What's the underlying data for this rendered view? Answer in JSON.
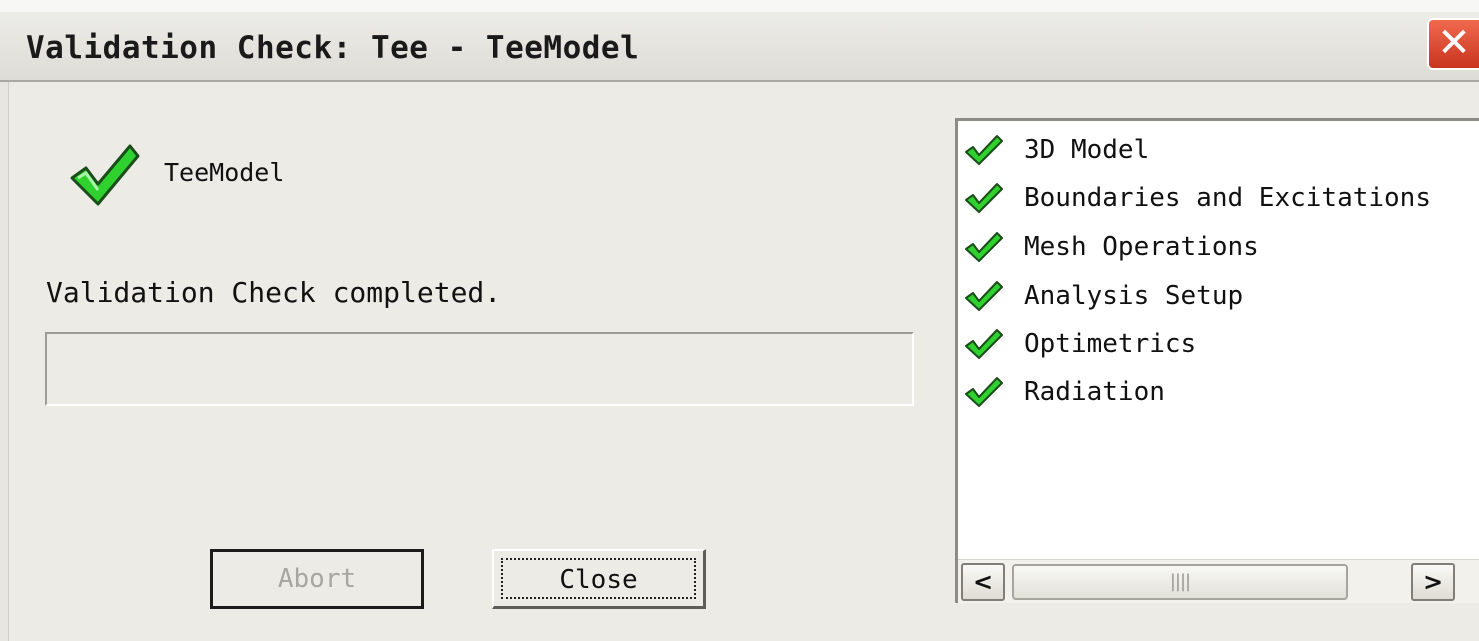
{
  "window": {
    "title": "Validation Check: Tee - TeeModel",
    "close_glyph": "✕"
  },
  "model": {
    "icon": "green-check-icon",
    "name": "TeeModel"
  },
  "status": {
    "message": "Validation Check completed."
  },
  "buttons": {
    "abort_label": "Abort",
    "close_label": "Close"
  },
  "checks": {
    "items": [
      {
        "label": "3D Model",
        "icon": "green-check-icon"
      },
      {
        "label": "Boundaries and Excitations",
        "icon": "green-check-icon"
      },
      {
        "label": "Mesh Operations",
        "icon": "green-check-icon"
      },
      {
        "label": "Analysis Setup",
        "icon": "green-check-icon"
      },
      {
        "label": "Optimetrics",
        "icon": "green-check-icon"
      },
      {
        "label": "Radiation",
        "icon": "green-check-icon"
      }
    ],
    "scroll_left_glyph": "<",
    "scroll_right_glyph": ">",
    "scroll_thumb_glyph": "||||"
  },
  "colors": {
    "check_green": "#2fd12f",
    "check_outline": "#1a4d1a",
    "close_red": "#d8432b"
  }
}
